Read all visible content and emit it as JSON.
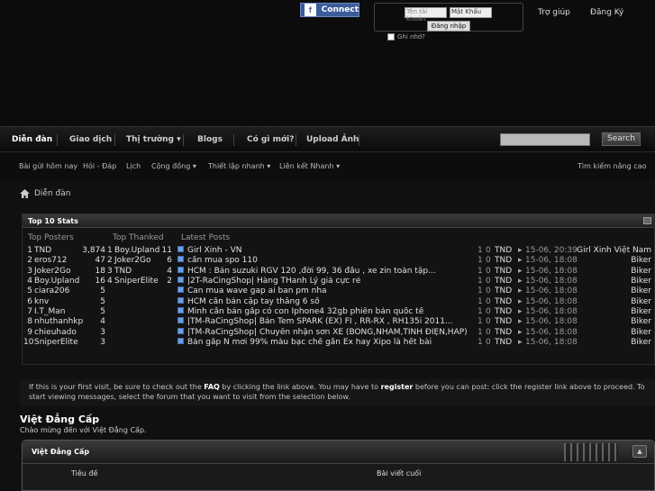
{
  "header": {
    "facebook_connect": "Connect",
    "facebook_glyph": "f",
    "username_placeholder": "Tên tài khoản",
    "password_placeholder": "Mật Khẩu",
    "login_button": "Đăng nhập",
    "remember_me": "Ghi nhớ?",
    "help": "Trợ giúp",
    "register": "Đăng Ký"
  },
  "navbar": {
    "tabs": [
      "Diễn đàn",
      "Giao dịch",
      "Thị trường ▾",
      "Blogs",
      "Có gì mới?",
      "Upload Ảnh"
    ],
    "search_button": "Search"
  },
  "subnav": {
    "items": [
      "Bài gửi hôm nay",
      "Hỏi - Đáp",
      "Lịch",
      "Cộng đồng ▾",
      "Thiết lập nhanh ▾",
      "Liên kết Nhanh ▾"
    ],
    "advanced_search": "Tìm kiếm nâng cao"
  },
  "breadcrumb": {
    "home": "Diễn đàn"
  },
  "stats": {
    "title": "Top 10 Stats",
    "col_posters": "Top Posters",
    "col_thanked": "Top Thanked",
    "col_latest": "Latest Posts",
    "rows": [
      {
        "rank": "1",
        "poster": "TND",
        "posts": "3,874",
        "trank": "1",
        "thanked": "Boy.Upland",
        "tcount": "11",
        "title": "Girl Xinh - VN",
        "replies": "1",
        "views": "0",
        "author": "TND",
        "arrow": "▸",
        "date": "15-06, 20:39",
        "forum": "Girl Xinh Việt Nam"
      },
      {
        "rank": "2",
        "poster": "eros712",
        "posts": "47",
        "trank": "2",
        "thanked": "Joker2Go",
        "tcount": "6",
        "title": "cần mua spo 110",
        "replies": "1",
        "views": "0",
        "author": "TND",
        "arrow": "▸",
        "date": "15-06, 18:08",
        "forum": "Biker"
      },
      {
        "rank": "3",
        "poster": "Joker2Go",
        "posts": "18",
        "trank": "3",
        "thanked": "TND",
        "tcount": "4",
        "title": "HCM : Bán suzuki RGV 120 ,đời 99, 36 đầu , xe zin toàn tập...",
        "replies": "1",
        "views": "0",
        "author": "TND",
        "arrow": "▸",
        "date": "15-06, 18:08",
        "forum": "Biker"
      },
      {
        "rank": "4",
        "poster": "Boy.Upland",
        "posts": "16",
        "trank": "4",
        "thanked": "SniperElite",
        "tcount": "2",
        "title": "|2T-RaCingShop| Hàng THanh Lý giá cực rẻ",
        "replies": "1",
        "views": "0",
        "author": "TND",
        "arrow": "▸",
        "date": "15-06, 18:08",
        "forum": "Biker"
      },
      {
        "rank": "5",
        "poster": "ciara206",
        "posts": "5",
        "trank": "",
        "thanked": "",
        "tcount": "",
        "title": "Can mua wave gap ai ban pm nha",
        "replies": "1",
        "views": "0",
        "author": "TND",
        "arrow": "▸",
        "date": "15-06, 18:08",
        "forum": "Biker"
      },
      {
        "rank": "6",
        "poster": "knv",
        "posts": "5",
        "trank": "",
        "thanked": "",
        "tcount": "",
        "title": "HCM cần bán cặp tay thắng 6 số",
        "replies": "1",
        "views": "0",
        "author": "TND",
        "arrow": "▸",
        "date": "15-06, 18:08",
        "forum": "Biker"
      },
      {
        "rank": "7",
        "poster": "I.T_Man",
        "posts": "5",
        "trank": "",
        "thanked": "",
        "tcount": "",
        "title": "Mình cần bán gấp có con Iphone4 32gb phiên bản quốc tế",
        "replies": "1",
        "views": "0",
        "author": "TND",
        "arrow": "▸",
        "date": "15-06, 18:08",
        "forum": "Biker"
      },
      {
        "rank": "8",
        "poster": "nhuthanhkp",
        "posts": "4",
        "trank": "",
        "thanked": "",
        "tcount": "",
        "title": "|TM-RaCingShop| Bán Tem SPARK (EX) FI , RR-RX , RH135i 2011...",
        "replies": "1",
        "views": "0",
        "author": "TND",
        "arrow": "▸",
        "date": "15-06, 18:08",
        "forum": "Biker"
      },
      {
        "rank": "9",
        "poster": "chieuhado",
        "posts": "3",
        "trank": "",
        "thanked": "",
        "tcount": "",
        "title": "|TM-RaCingShop| Chuyên nhận sơn XE (BÓNG,NHÁM,TỈNH ĐIỆN,HẤP)",
        "replies": "1",
        "views": "0",
        "author": "TND",
        "arrow": "▸",
        "date": "15-06, 18:08",
        "forum": "Biker"
      },
      {
        "rank": "10",
        "poster": "SniperElite",
        "posts": "3",
        "trank": "",
        "thanked": "",
        "tcount": "",
        "title": "Bán gấp N mơi 99% màu bạc chế gần Ex hay Xipo là hết bài",
        "replies": "1",
        "views": "0",
        "author": "TND",
        "arrow": "▸",
        "date": "15-06, 18:08",
        "forum": "Biker"
      }
    ]
  },
  "notice": {
    "part1": "If this is your first visit, be sure to check out the ",
    "faq": "FAQ",
    "part2": " by clicking the link above. You may have to ",
    "register": "register",
    "part3": " before you can post: click the register link above to proceed. To start viewing messages, select the forum that you want to visit from the selection below."
  },
  "forum": {
    "title": "Việt Đẳng Cấp",
    "description": "Chào mừng đến với Việt Đẳng Cấp.",
    "box_title": "Việt Đẳng Cấp",
    "collapse": "▲",
    "col_topic": "Tiêu đề",
    "col_last": "Bài viết cuối"
  }
}
